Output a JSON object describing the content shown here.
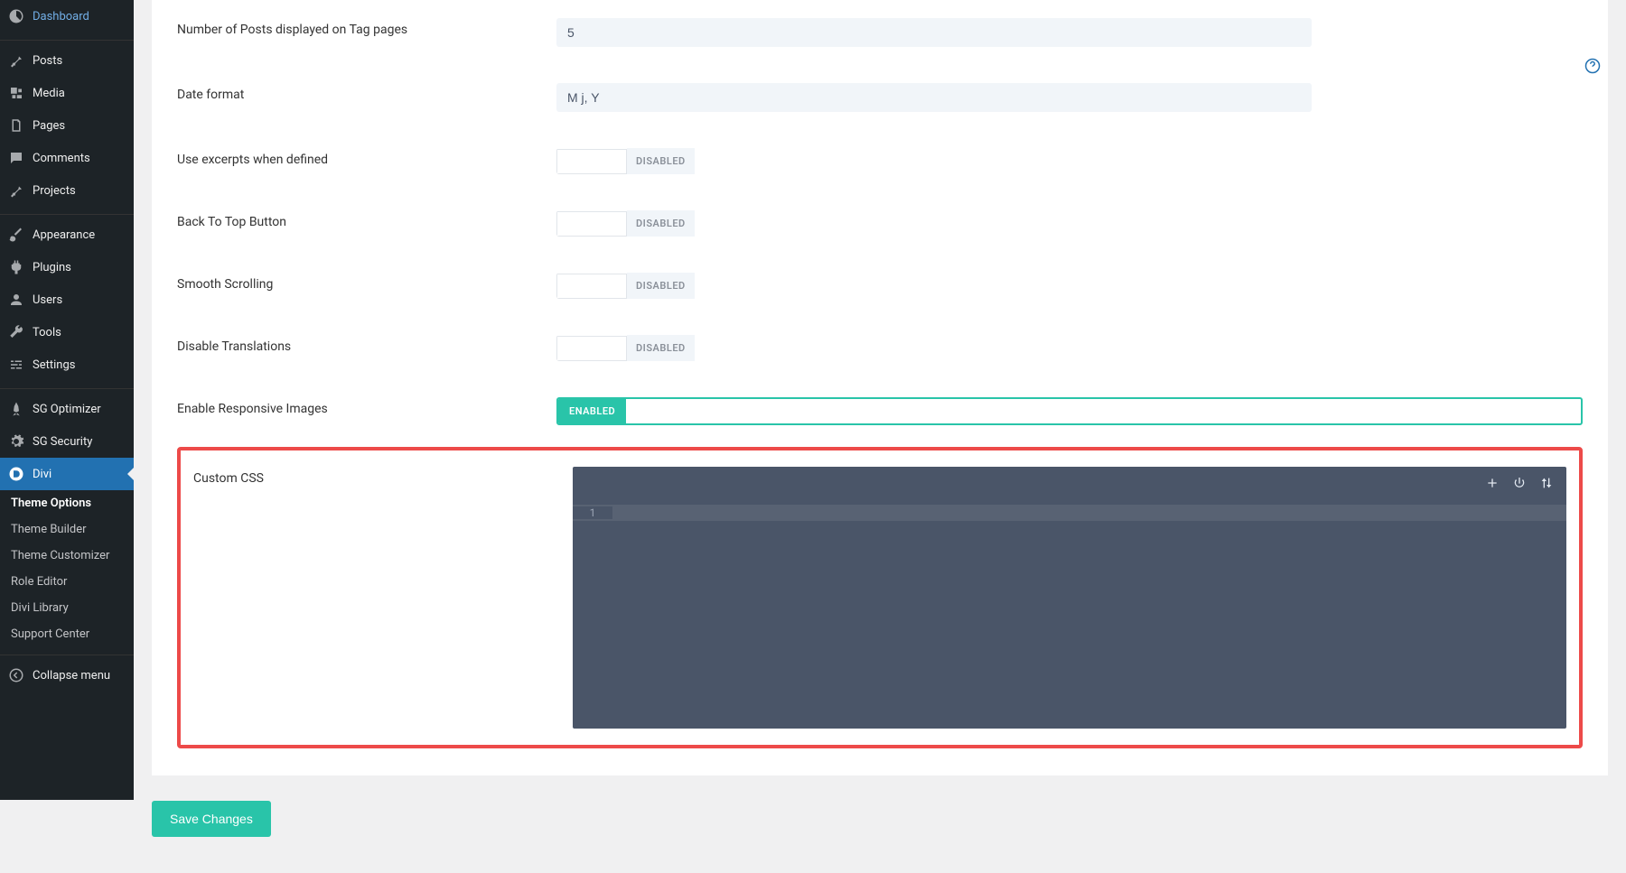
{
  "sidebar": {
    "items": [
      {
        "label": "Dashboard",
        "icon": "dashboard-icon"
      },
      {
        "label": "Posts",
        "icon": "pin-icon"
      },
      {
        "label": "Media",
        "icon": "media-icon"
      },
      {
        "label": "Pages",
        "icon": "pages-icon"
      },
      {
        "label": "Comments",
        "icon": "comments-icon"
      },
      {
        "label": "Projects",
        "icon": "pin-icon"
      },
      {
        "label": "Appearance",
        "icon": "brush-icon"
      },
      {
        "label": "Plugins",
        "icon": "plug-icon"
      },
      {
        "label": "Users",
        "icon": "user-icon"
      },
      {
        "label": "Tools",
        "icon": "wrench-icon"
      },
      {
        "label": "Settings",
        "icon": "sliders-icon"
      },
      {
        "label": "SG Optimizer",
        "icon": "rocket-icon"
      },
      {
        "label": "SG Security",
        "icon": "gear-icon"
      },
      {
        "label": "Divi",
        "icon": "divi-icon",
        "active": true
      }
    ],
    "submenu": [
      {
        "label": "Theme Options",
        "active": true
      },
      {
        "label": "Theme Builder"
      },
      {
        "label": "Theme Customizer"
      },
      {
        "label": "Role Editor"
      },
      {
        "label": "Divi Library"
      },
      {
        "label": "Support Center"
      }
    ],
    "collapse_label": "Collapse menu"
  },
  "settings": {
    "posts_tag_label": "Number of Posts displayed on Tag pages",
    "posts_tag_value": "5",
    "date_format_label": "Date format",
    "date_format_value": "M j, Y",
    "excerpts_label": "Use excerpts when defined",
    "back_top_label": "Back To Top Button",
    "smooth_scroll_label": "Smooth Scrolling",
    "disable_trans_label": "Disable Translations",
    "responsive_label": "Enable Responsive Images",
    "custom_css_label": "Custom CSS",
    "disabled_text": "DISABLED",
    "enabled_text": "ENABLED",
    "line_number": "1"
  },
  "save_button": "Save Changes"
}
